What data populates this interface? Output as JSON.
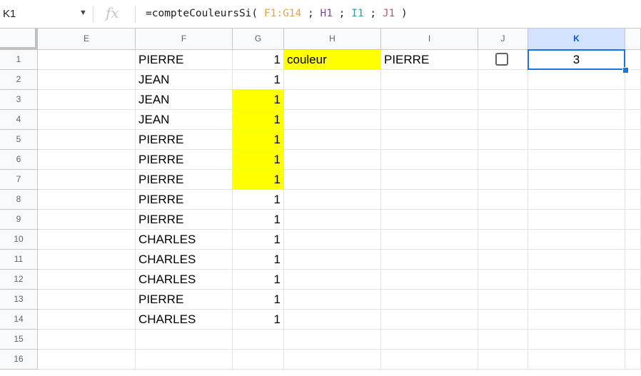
{
  "formula_bar": {
    "name_box": "K1",
    "fx_label": "fx",
    "formula_parts": [
      "=compteCouleursSi( ",
      "F1:G14",
      " ; ",
      "H1",
      " ; ",
      "I1",
      " ; ",
      "J1",
      " )"
    ]
  },
  "columns": [
    "E",
    "F",
    "G",
    "H",
    "I",
    "J",
    "K"
  ],
  "rows": [
    "1",
    "2",
    "3",
    "4",
    "5",
    "6",
    "7",
    "8",
    "9",
    "10",
    "11",
    "12",
    "13",
    "14",
    "15",
    "16"
  ],
  "cells": {
    "F": [
      "PIERRE",
      "JEAN",
      "JEAN",
      "JEAN",
      "PIERRE",
      "PIERRE",
      "PIERRE",
      "PIERRE",
      "PIERRE",
      "CHARLES",
      "CHARLES",
      "CHARLES",
      "PIERRE",
      "CHARLES",
      "",
      ""
    ],
    "G": [
      "1",
      "1",
      "1",
      "1",
      "1",
      "1",
      "1",
      "1",
      "1",
      "1",
      "1",
      "1",
      "1",
      "1",
      "",
      ""
    ],
    "H1": "couleur",
    "I1": "PIERRE",
    "J1_checked": false,
    "K1": "3"
  },
  "colors": {
    "highlight": "#ffff00",
    "selection": "#1a73e8"
  },
  "highlighted_cells": [
    "G3",
    "G4",
    "G5",
    "G6",
    "G7",
    "H1"
  ],
  "selected_cell": "K1"
}
